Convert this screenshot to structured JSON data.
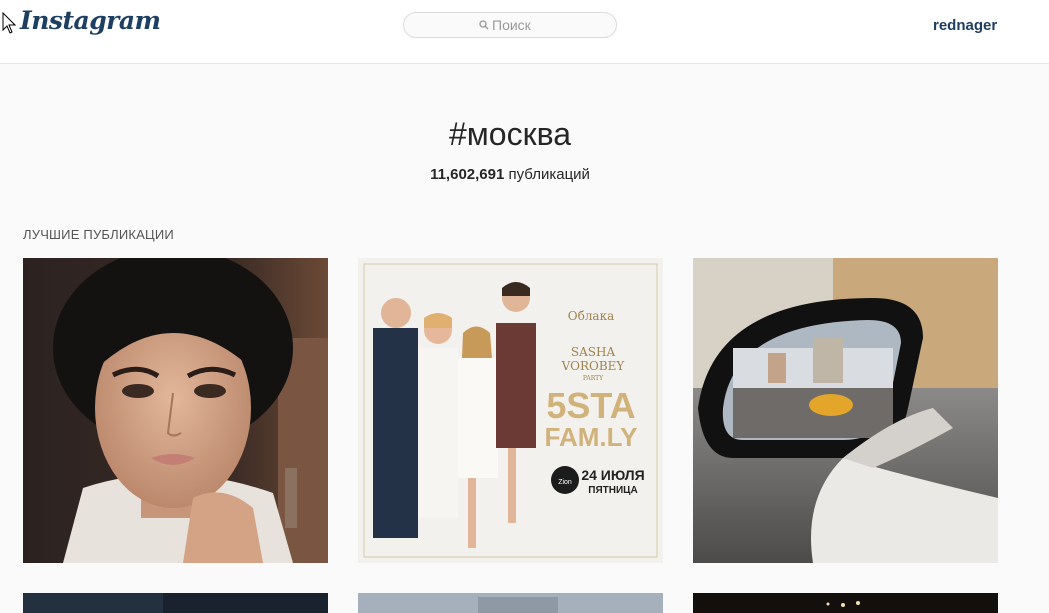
{
  "header": {
    "logo": "Instagram",
    "search_placeholder": "Поиск",
    "username": "rednager"
  },
  "hashtag": {
    "title": "#москва",
    "post_count": "11,602,691",
    "post_count_suffix": " публикаций"
  },
  "top_posts": {
    "label": "ЛУЧШИЕ ПУБЛИКАЦИИ",
    "items": [
      {
        "description": "portrait photo"
      },
      {
        "description": "5sta family promo poster",
        "poster": {
          "venue": "Облака",
          "sasha": "SASHA",
          "vorobey": "VOROBEY",
          "party": "PARTY",
          "band_line1": "5STA",
          "band_line2": "FAM.LY",
          "date": "24 ИЮЛЯ",
          "weekday": "ПЯТНИЦА",
          "badge": "Zion"
        }
      },
      {
        "description": "car side mirror street photo"
      }
    ]
  }
}
